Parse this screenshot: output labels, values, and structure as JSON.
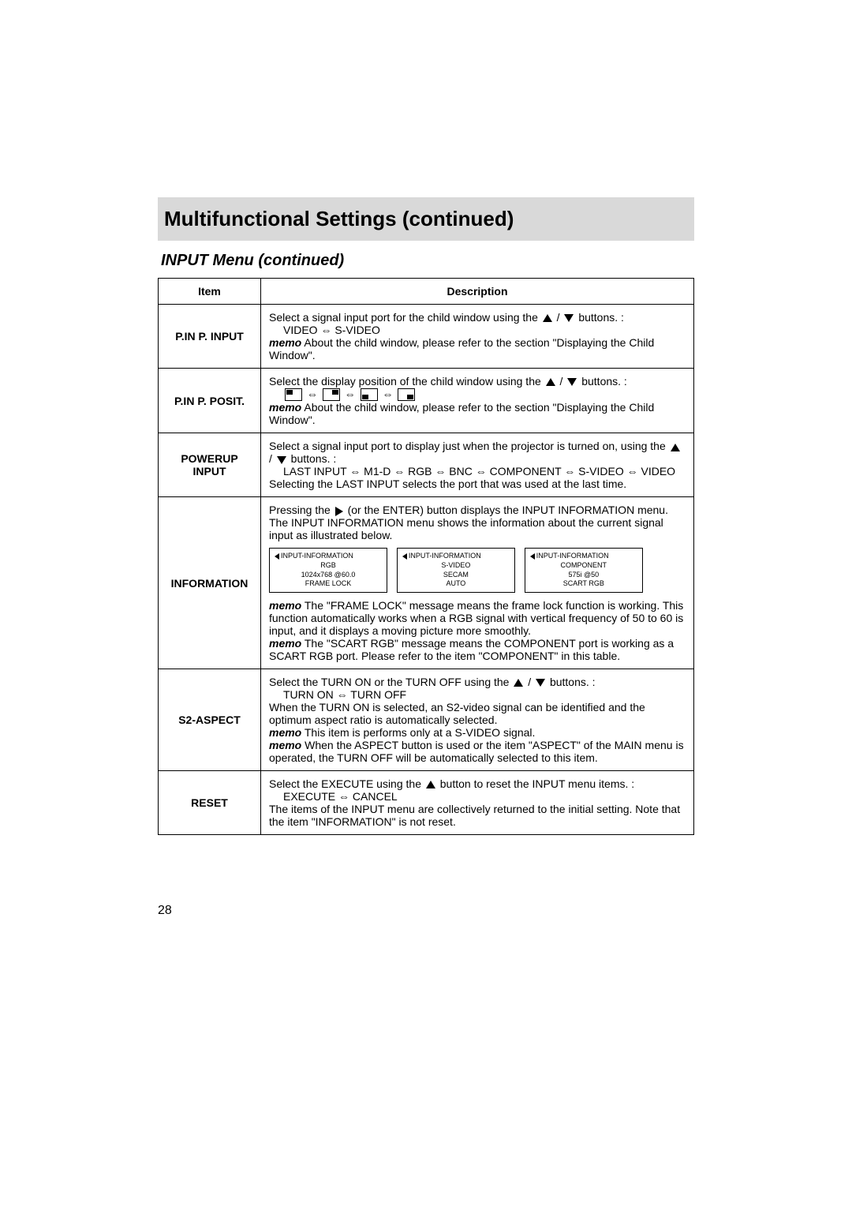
{
  "title": "Multifunctional Settings (continued)",
  "subtitle": "INPUT Menu (continued)",
  "headers": {
    "item": "Item",
    "description": "Description"
  },
  "rows": {
    "pinp_input": {
      "label": "P.IN P. INPUT",
      "line1a": "Select a signal input port for the child window using the ",
      "line1b": " / ",
      "line1c": " buttons. :",
      "line2": "VIDEO ⇔ S-VIDEO",
      "memo_label": "memo",
      "memo_text": " About the child window, please refer to the section \"Displaying the Child Window\"."
    },
    "pinp_posit": {
      "label": "P.IN P. POSIT.",
      "line1a": "Select the display position of the child window using the ",
      "line1b": " / ",
      "line1c": " buttons. :",
      "memo_label": "memo",
      "memo_text": " About the child window, please refer to the section \"Displaying the Child Window\"."
    },
    "powerup": {
      "label": "POWERUP INPUT",
      "line1a": "Select a signal input port to display just when the projector is turned on, using the ",
      "line1b": " / ",
      "line1c": " buttons. :",
      "line2": "LAST INPUT ⇔ M1-D ⇔ RGB ⇔ BNC ⇔ COMPONENT ⇔ S-VIDEO ⇔ VIDEO",
      "line3": "Selecting the LAST INPUT selects the port that was used at the last time."
    },
    "information": {
      "label": "INFORMATION",
      "p1a": "Pressing the ",
      "p1b": " (or the ENTER) button displays the INPUT INFORMATION menu.",
      "p2": "The INPUT INFORMATION menu shows the information about the current signal input as illustrated below.",
      "box1": {
        "h": "INPUT-INFORMATION",
        "a": "RGB",
        "b": "1024x768 @60.0",
        "c": "FRAME LOCK"
      },
      "box2": {
        "h": "INPUT-INFORMATION",
        "a": "S-VIDEO",
        "b": "SECAM",
        "c": "AUTO"
      },
      "box3": {
        "h": "INPUT-INFORMATION",
        "a": "COMPONENT",
        "b": "575i @50",
        "c": "SCART RGB"
      },
      "memo1_label": "memo",
      "memo1_text": " The \"FRAME LOCK\" message means the frame lock function is working. This function automatically works when a RGB signal with vertical frequency of 50 to 60 is input, and it displays a moving picture more smoothly.",
      "memo2_label": "memo",
      "memo2_text": " The \"SCART RGB\" message means the COMPONENT port is working as a SCART RGB port. Please refer to the item \"COMPONENT\" in this table."
    },
    "s2aspect": {
      "label": "S2-ASPECT",
      "line1a": "Select the TURN ON or the TURN OFF using the ",
      "line1b": " / ",
      "line1c": " buttons. :",
      "line2": "TURN ON ⇔ TURN OFF",
      "line3": "When the TURN ON is selected, an S2-video signal can be identified and the optimum aspect ratio is automatically selected.",
      "memo1_label": "memo",
      "memo1_text": " This item is performs only at a S-VIDEO signal.",
      "memo2_label": "memo",
      "memo2_text": " When the ASPECT button is used or the item \"ASPECT\" of the MAIN menu is operated, the TURN OFF will be automatically selected to this item."
    },
    "reset": {
      "label": "RESET",
      "line1a": "Select the EXECUTE using the ",
      "line1b": " button to reset the INPUT menu items. :",
      "line2": "EXECUTE ⇔ CANCEL",
      "line3": "The items of the INPUT menu are collectively returned to the initial setting. Note that the item \"INFORMATION\" is not reset."
    }
  },
  "page_number": "28"
}
